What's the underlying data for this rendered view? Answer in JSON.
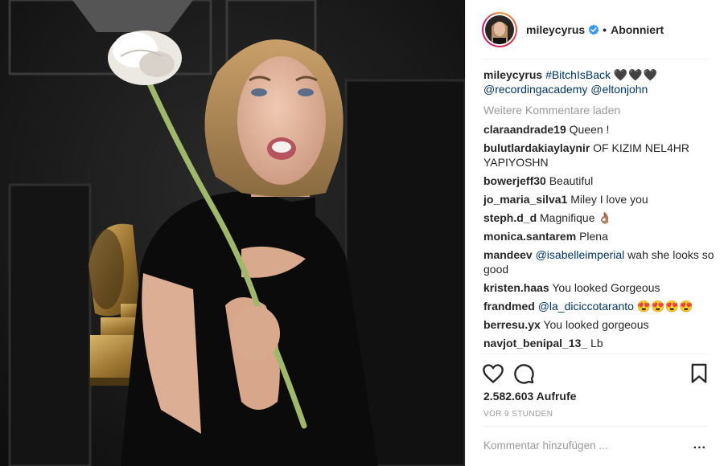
{
  "header": {
    "username": "mileycyrus",
    "separator": "•",
    "follow_status": "Abonniert"
  },
  "caption": {
    "username": "mileycyrus",
    "hashtag": "#BitchIsBack",
    "emoji": "🖤🖤🖤",
    "mentions": [
      "@recordingacademy",
      "@eltonjohn"
    ]
  },
  "load_more": "Weitere Kommentare laden",
  "comments": [
    {
      "user": "claraandrade19",
      "parts": [
        {
          "text": "Queen !"
        }
      ]
    },
    {
      "user": "bulutlardakiaylaynir",
      "parts": [
        {
          "text": "OF KIZIM NEL4HR YAPIYOSHN"
        }
      ]
    },
    {
      "user": "bowerjeff30",
      "parts": [
        {
          "text": "Beautiful"
        }
      ]
    },
    {
      "user": "jo_maria_silva1",
      "parts": [
        {
          "text": "Miley I love you"
        }
      ]
    },
    {
      "user": "steph.d_d",
      "parts": [
        {
          "text": "Magnifique 👌🏽"
        }
      ]
    },
    {
      "user": "monica.santarem",
      "parts": [
        {
          "text": "Plena"
        }
      ]
    },
    {
      "user": "mandeev",
      "parts": [
        {
          "text": "@isabelleimperial",
          "tag": true
        },
        {
          "text": " wah she looks so good"
        }
      ]
    },
    {
      "user": "kristen.haas",
      "parts": [
        {
          "text": "You looked Gorgeous"
        }
      ]
    },
    {
      "user": "frandmed",
      "parts": [
        {
          "text": "@la_diciccotaranto",
          "tag": true
        },
        {
          "text": " 😍😍😍😍"
        }
      ]
    },
    {
      "user": "berresu.yx",
      "parts": [
        {
          "text": "You looked gorgeous"
        }
      ]
    },
    {
      "user": "navjot_benipal_13_",
      "parts": [
        {
          "text": "Lb"
        }
      ]
    }
  ],
  "stats": {
    "views": "2.582.603 Aufrufe",
    "time": "VOR 9 STUNDEN"
  },
  "comment_box": {
    "placeholder": "Kommentar hinzufügen ...",
    "options": "..."
  },
  "colors": {
    "mention": "#003569",
    "verified": "#3897f0",
    "muted": "#999999"
  },
  "icons": [
    "heart-icon",
    "comment-icon",
    "bookmark-icon",
    "verified-badge-icon"
  ]
}
